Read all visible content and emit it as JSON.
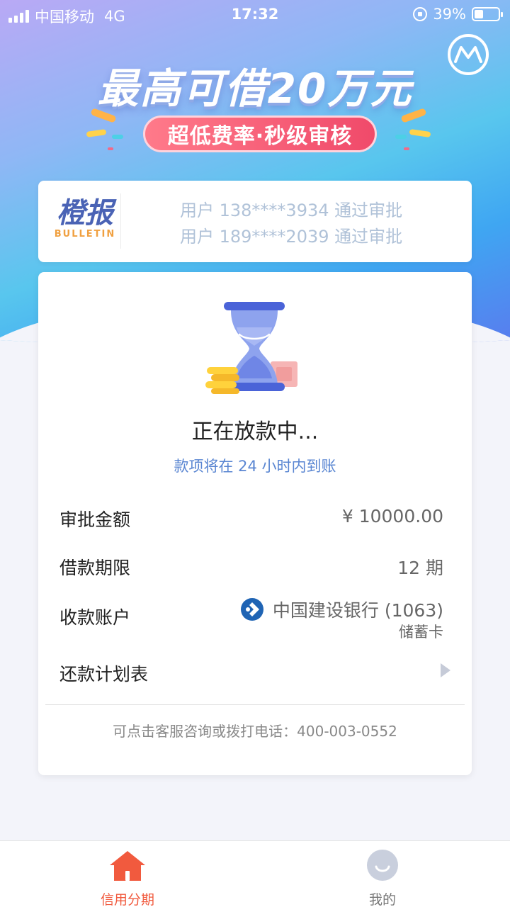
{
  "status_bar": {
    "carrier": "中国移动",
    "network": "4G",
    "time": "17:32",
    "battery": "39%"
  },
  "banner": {
    "title": "最高可借20万元",
    "subtitle": "超低费率·秒级审核"
  },
  "bulletin": {
    "logo_cn": "橙报",
    "logo_en": "BULLETIN",
    "lines": [
      "用户 138****3934 通过审批",
      "用户 189****2039 通过审批"
    ]
  },
  "loan": {
    "status_title": "正在放款中...",
    "status_subtitle": "款项将在 24 小时内到账",
    "amount_label": "审批金额",
    "amount_value": "¥ 10000.00",
    "term_label": "借款期限",
    "term_value": "12 期",
    "account_label": "收款账户",
    "account_bank": "中国建设银行 (1063)",
    "account_type": "储蓄卡",
    "plan_label": "还款计划表",
    "service_text": "可点击客服咨询或拨打电话：400-003-0552"
  },
  "tabs": [
    {
      "label": "信用分期",
      "icon": "home-icon",
      "active": true
    },
    {
      "label": "我的",
      "icon": "user-icon",
      "active": false
    }
  ],
  "colors": {
    "accent": "#f15a3e",
    "link_blue": "#5a86d2",
    "bank_blue": "#1f64b4"
  }
}
